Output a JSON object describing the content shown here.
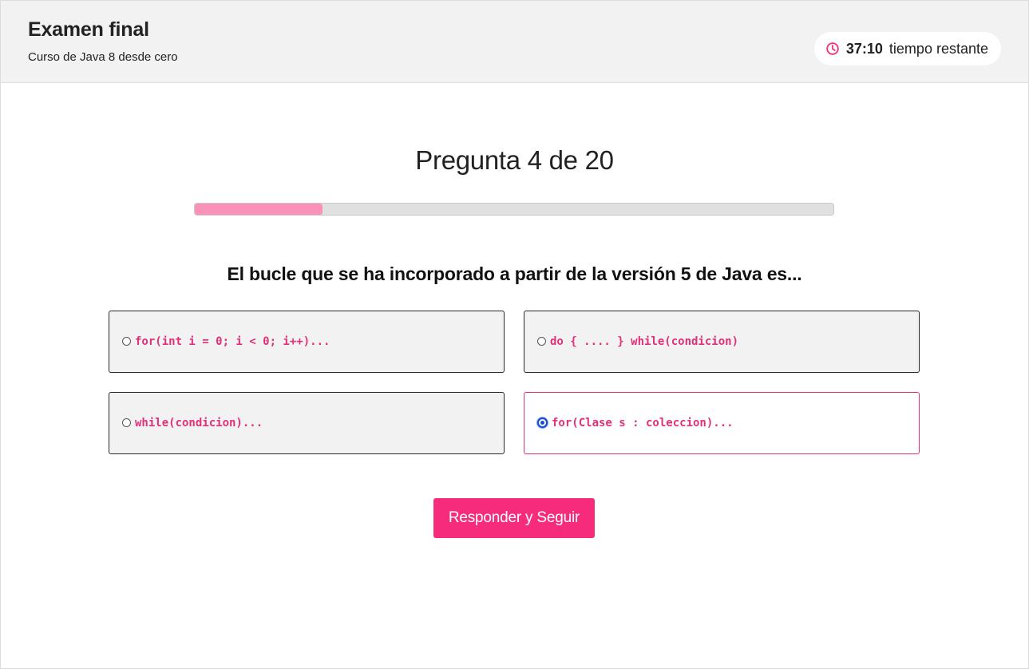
{
  "header": {
    "title": "Examen final",
    "course": "Curso de Java 8 desde cero",
    "timer": {
      "icon": "clock-icon",
      "value": "37:10",
      "label": "tiempo restante"
    }
  },
  "quiz": {
    "question_counter": "Pregunta 4 de 20",
    "progress_fraction": 0.2,
    "question": "El bucle que se ha incorporado a partir de la versión 5 de Java es...",
    "options": [
      {
        "code": "for(int i = 0; i < 0; i++)...",
        "selected": false
      },
      {
        "code": "do { .... } while(condicion)",
        "selected": false
      },
      {
        "code": "while(condicion)...",
        "selected": false
      },
      {
        "code": "for(Clase s : coleccion)...",
        "selected": true
      }
    ],
    "submit_label": "Responder y Seguir"
  },
  "colors": {
    "accent": "#f72b7b",
    "code_text": "#e0307a",
    "progress_fill": "#f991b8",
    "radio_selected": "#1a4fd0"
  }
}
